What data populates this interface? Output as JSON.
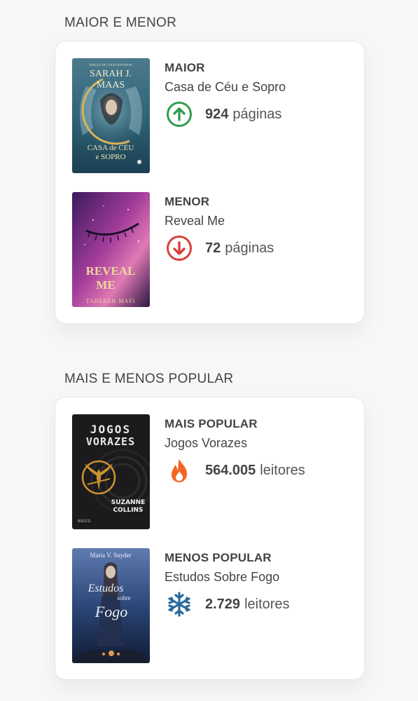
{
  "size_section": {
    "title": "MAIOR E MENOR",
    "largest": {
      "label": "MAIOR",
      "book_title": "Casa de Céu e Sopro",
      "value": "924",
      "unit": "páginas",
      "icon": "arrow-up-circle-icon",
      "icon_color": "#2e9e4f",
      "cover_text": {
        "edition": "EDIÇÃO DE COLECIONADOR",
        "author_line1": "SARAH J.",
        "author_line2": "MAAS",
        "title_line1": "CASA de CÉU",
        "title_line2": "e SOPRO"
      }
    },
    "smallest": {
      "label": "MENOR",
      "book_title": "Reveal Me",
      "value": "72",
      "unit": "páginas",
      "icon": "arrow-down-circle-icon",
      "icon_color": "#d9403a",
      "cover_text": {
        "title_line1": "REVEAL",
        "title_line2": "ME",
        "author": "TAHEREH MAFI"
      }
    }
  },
  "popularity_section": {
    "title": "MAIS E MENOS POPULAR",
    "most_popular": {
      "label": "MAIS POPULAR",
      "book_title": "Jogos Vorazes",
      "value": "564.005",
      "unit": "leitores",
      "icon": "fire-icon",
      "icon_color": "#f26522",
      "cover_text": {
        "title_line1": "JOGOS",
        "title_line2": "VORAZES",
        "author_line1": "SUZANNE",
        "author_line2": "COLLINS",
        "publisher": "ROCCO"
      }
    },
    "least_popular": {
      "label": "MENOS POPULAR",
      "book_title": "Estudos Sobre Fogo",
      "value": "2.729",
      "unit": "leitores",
      "icon": "snowflake-icon",
      "icon_color": "#2b6a9e",
      "cover_text": {
        "author": "Maria V. Snyder",
        "title_line1": "Estudos",
        "title_line2": "sobre",
        "title_line3": "Fogo"
      }
    }
  }
}
